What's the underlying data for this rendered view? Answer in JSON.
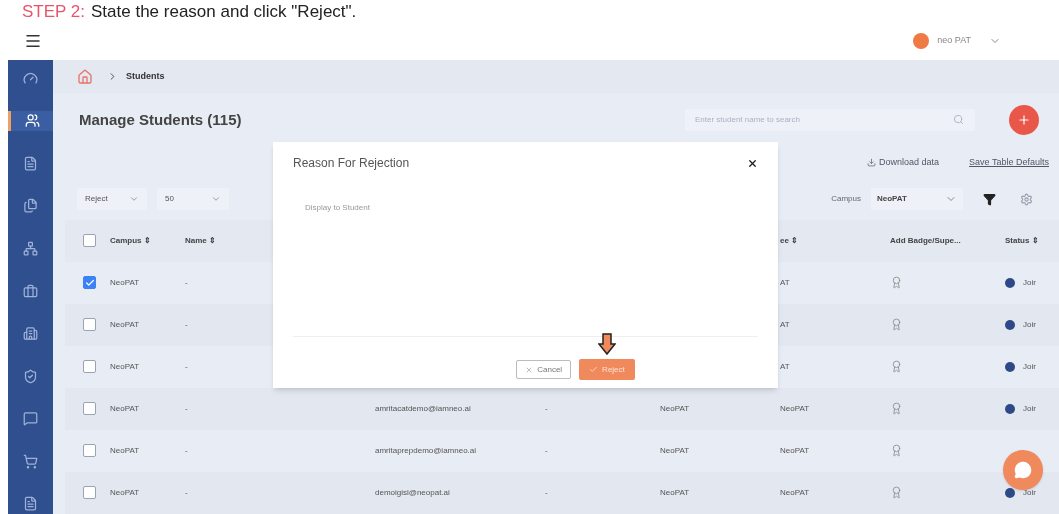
{
  "instruction": {
    "step": "STEP 2:",
    "text": "State the reason and click \"Reject\"."
  },
  "header": {
    "user": "neo PAT"
  },
  "sidebar": {
    "items": [
      {
        "selected": false
      },
      {
        "selected": true
      },
      {
        "selected": false
      },
      {
        "selected": false
      },
      {
        "selected": false
      },
      {
        "selected": false
      },
      {
        "selected": false
      },
      {
        "selected": false
      },
      {
        "selected": false
      },
      {
        "selected": false
      },
      {
        "selected": false
      }
    ]
  },
  "breadcrumb": [
    "Students"
  ],
  "page_title": "Manage Students (115)",
  "search": {
    "placeholder": "Enter student name to search"
  },
  "actions": {
    "download": "Download data",
    "save_defaults": "Save Table Defaults"
  },
  "filters": {
    "action": "Reject",
    "page_size": "50",
    "campus_label": "Campus",
    "campus": "NeoPAT"
  },
  "table": {
    "select_all": {
      "checked": false
    },
    "columns": [
      {
        "kind": "campus",
        "label": "Campus ⇕"
      },
      {
        "kind": "name",
        "label": "Name ⇕"
      },
      {
        "kind": "college",
        "label": "ee ⇕"
      },
      {
        "kind": "badge",
        "label": "Add Badge/Supe..."
      },
      {
        "kind": "status",
        "label": "Status ⇕"
      }
    ],
    "rows": [
      {
        "checked": true,
        "campus": "NeoPAT",
        "name": "-",
        "college": "AT",
        "status": "Joir"
      },
      {
        "checked": false,
        "campus": "NeoPAT",
        "name": "-",
        "college": "AT",
        "status": "Joir"
      },
      {
        "checked": false,
        "campus": "NeoPAT",
        "name": "-",
        "college": "AT",
        "status": "Joir"
      },
      {
        "checked": false,
        "campus": "NeoPAT",
        "name": "-",
        "email": "amritacatdemo@iamneo.ai",
        "col_4": "-",
        "institute": "NeoPAT",
        "college": "NeoPAT",
        "status": "Joir"
      },
      {
        "checked": false,
        "campus": "NeoPAT",
        "name": "-",
        "email": "amritaprepdemo@iamneo.ai",
        "col_4": "-",
        "institute": "NeoPAT",
        "college": "NeoPAT"
      },
      {
        "checked": false,
        "campus": "NeoPAT",
        "name": "-",
        "email": "demoigisl@neopat.ai",
        "col_4": "-",
        "institute": "NeoPAT",
        "college": "NeoPAT",
        "status": "Joir"
      }
    ]
  },
  "modal": {
    "title": "Reason For Rejection",
    "field_label": "Display to Student",
    "buttons": [
      {
        "kind": "cancel",
        "label": "Cancel"
      },
      {
        "kind": "confirm",
        "label": "Reject"
      }
    ]
  }
}
